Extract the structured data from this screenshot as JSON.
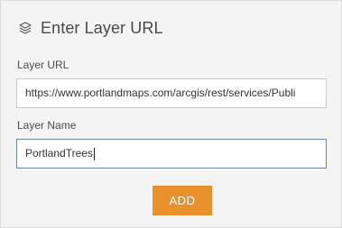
{
  "header": {
    "title": "Enter Layer URL",
    "icon": "layers-icon"
  },
  "form": {
    "url_label": "Layer URL",
    "url_value": "https://www.portlandmaps.com/arcgis/rest/services/Publi",
    "name_label": "Layer Name",
    "name_value": "PortlandTrees"
  },
  "actions": {
    "add_label": "ADD",
    "add_color": "#e8912d"
  }
}
